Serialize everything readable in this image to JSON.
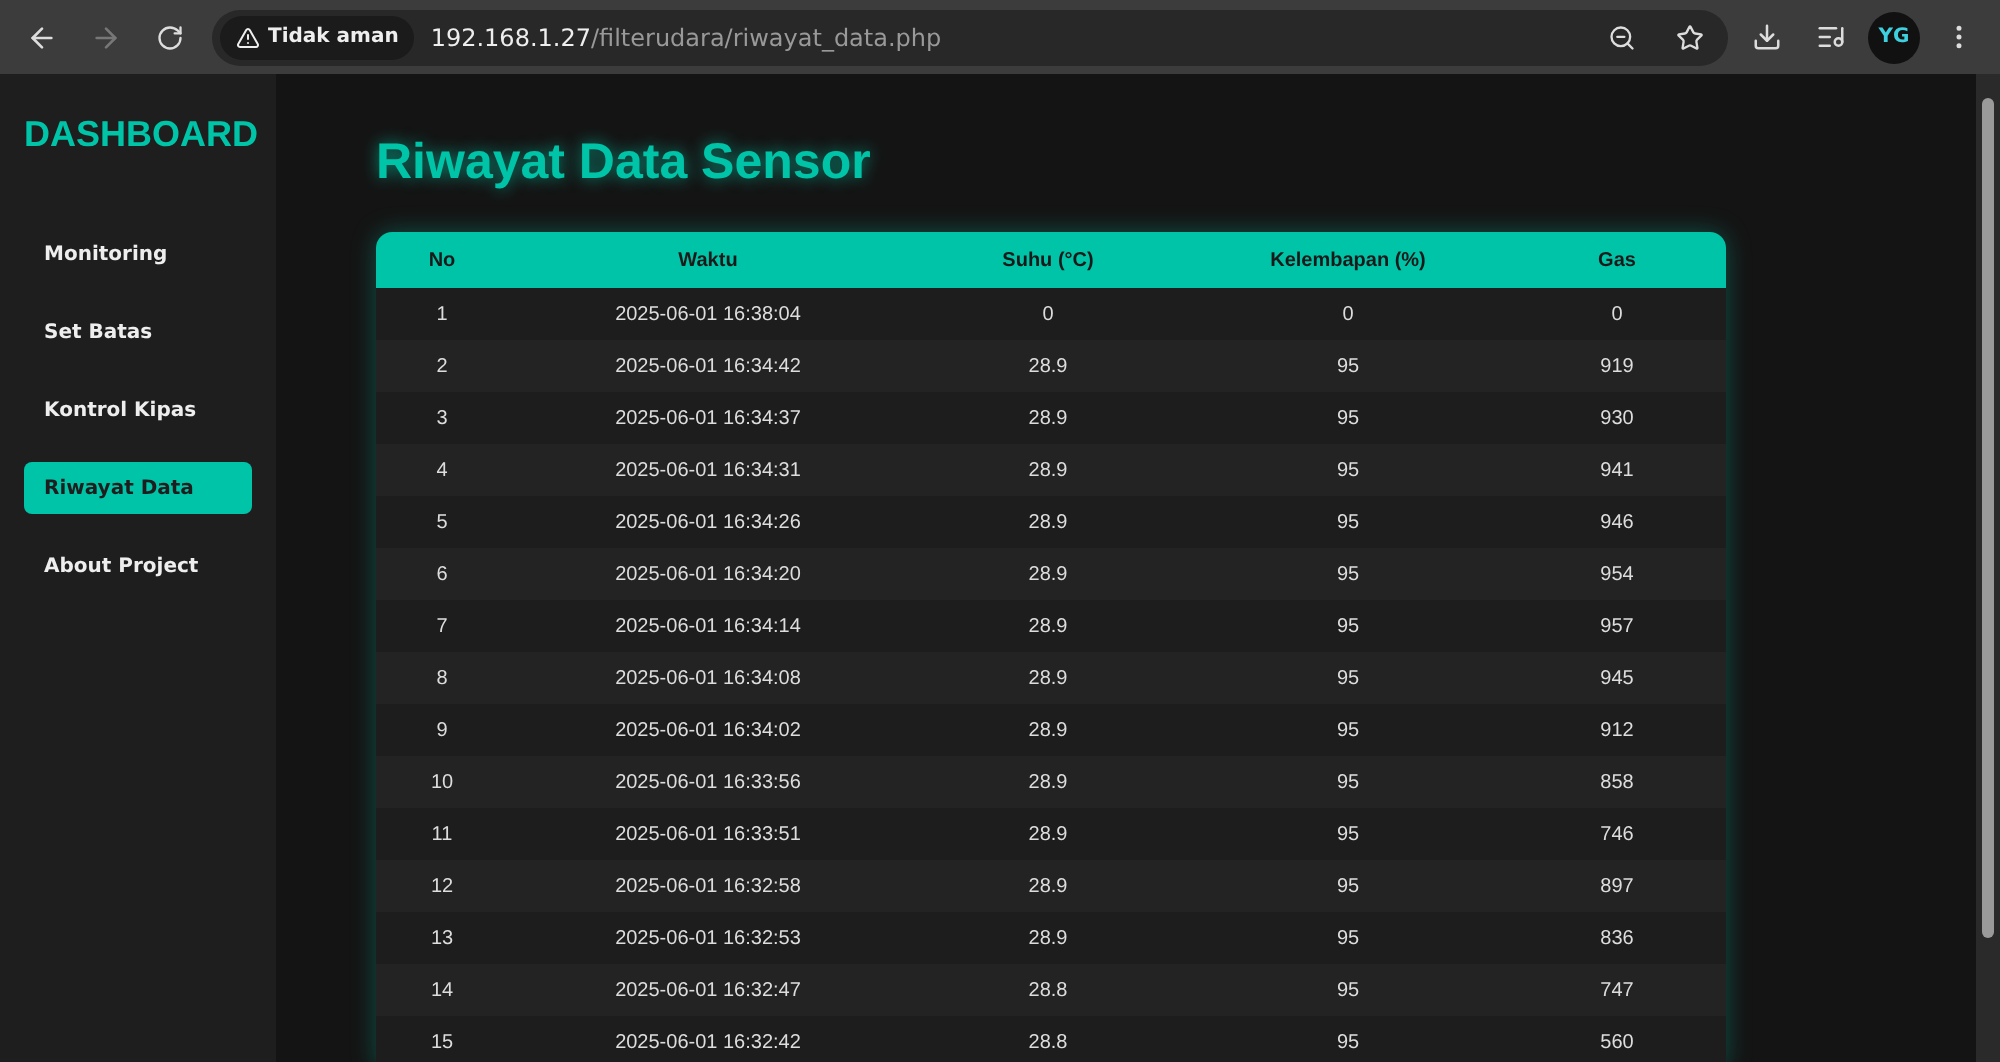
{
  "browser": {
    "security_label": "Tidak aman",
    "url_host": "192.168.1.27",
    "url_path": "/filterudara/riwayat_data.php",
    "profile": "YG"
  },
  "sidebar": {
    "title": "DASHBOARD",
    "items": [
      {
        "label": "Monitoring",
        "selected": false
      },
      {
        "label": "Set Batas",
        "selected": false
      },
      {
        "label": "Kontrol Kipas",
        "selected": false
      },
      {
        "label": "Riwayat Data",
        "selected": true
      },
      {
        "label": "About Project",
        "selected": false
      }
    ]
  },
  "page": {
    "title": "Riwayat Data Sensor"
  },
  "table": {
    "columns": [
      "No",
      "Waktu",
      "Suhu (°C)",
      "Kelembapan (%)",
      "Gas"
    ],
    "rows": [
      [
        "1",
        "2025-06-01 16:38:04",
        "0",
        "0",
        "0"
      ],
      [
        "2",
        "2025-06-01 16:34:42",
        "28.9",
        "95",
        "919"
      ],
      [
        "3",
        "2025-06-01 16:34:37",
        "28.9",
        "95",
        "930"
      ],
      [
        "4",
        "2025-06-01 16:34:31",
        "28.9",
        "95",
        "941"
      ],
      [
        "5",
        "2025-06-01 16:34:26",
        "28.9",
        "95",
        "946"
      ],
      [
        "6",
        "2025-06-01 16:34:20",
        "28.9",
        "95",
        "954"
      ],
      [
        "7",
        "2025-06-01 16:34:14",
        "28.9",
        "95",
        "957"
      ],
      [
        "8",
        "2025-06-01 16:34:08",
        "28.9",
        "95",
        "945"
      ],
      [
        "9",
        "2025-06-01 16:34:02",
        "28.9",
        "95",
        "912"
      ],
      [
        "10",
        "2025-06-01 16:33:56",
        "28.9",
        "95",
        "858"
      ],
      [
        "11",
        "2025-06-01 16:33:51",
        "28.9",
        "95",
        "746"
      ],
      [
        "12",
        "2025-06-01 16:32:58",
        "28.9",
        "95",
        "897"
      ],
      [
        "13",
        "2025-06-01 16:32:53",
        "28.9",
        "95",
        "836"
      ],
      [
        "14",
        "2025-06-01 16:32:47",
        "28.8",
        "95",
        "747"
      ],
      [
        "15",
        "2025-06-01 16:32:42",
        "28.8",
        "95",
        "560"
      ]
    ]
  }
}
